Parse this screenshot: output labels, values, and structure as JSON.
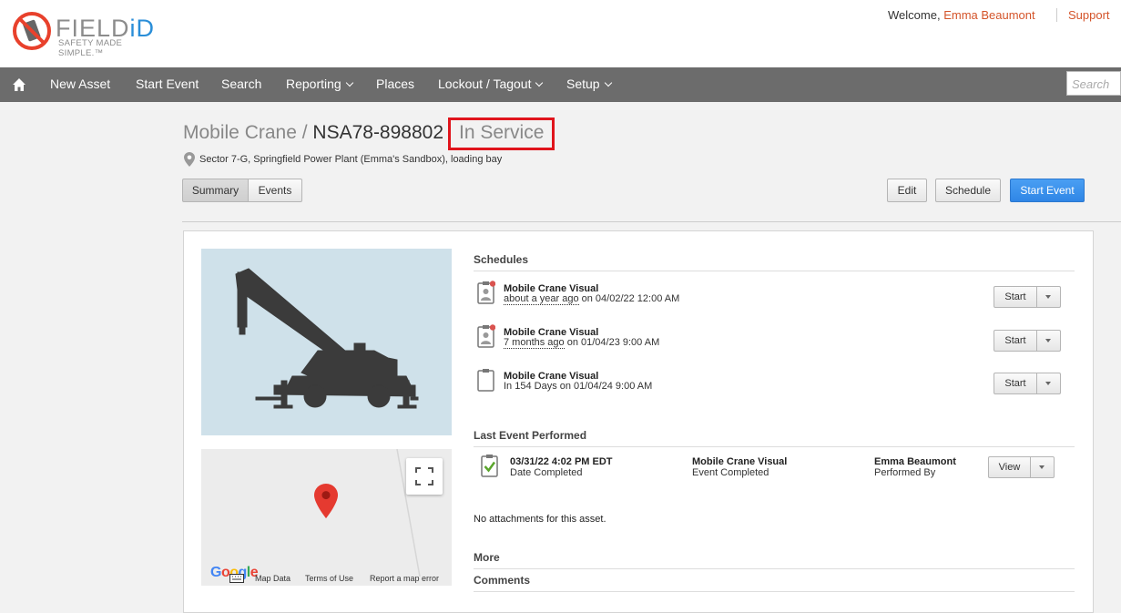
{
  "header": {
    "logo_text": "FIELD",
    "logo_accent": "iD",
    "logo_tagline": "SAFETY MADE SIMPLE.™",
    "welcome_label": "Welcome,",
    "user_name": "Emma Beaumont",
    "support_label": "Support"
  },
  "nav": {
    "items": [
      "New Asset",
      "Start Event",
      "Search",
      "Reporting",
      "Places",
      "Lockout / Tagout",
      "Setup"
    ],
    "search_placeholder": "Search"
  },
  "asset": {
    "type": "Mobile Crane /",
    "serial": "NSA78-898802",
    "status": "In Service",
    "location": "Sector 7-G, Springfield Power Plant (Emma's Sandbox), loading bay"
  },
  "tabs": [
    "Summary",
    "Events"
  ],
  "actions": {
    "edit": "Edit",
    "schedule": "Schedule",
    "start_event": "Start Event"
  },
  "schedules": {
    "heading": "Schedules",
    "items": [
      {
        "name": "Mobile Crane Visual",
        "relative": "about a year ago",
        "date": " on 04/02/22 12:00 AM",
        "button": "Start"
      },
      {
        "name": "Mobile Crane Visual",
        "relative": "7 months ago",
        "date": " on 01/04/23 9:00 AM",
        "button": "Start"
      },
      {
        "name": "Mobile Crane Visual",
        "relative": "",
        "date": "In 154 Days on 01/04/24 9:00 AM",
        "button": "Start"
      }
    ]
  },
  "last_event": {
    "heading": "Last Event Performed",
    "date": "03/31/22 4:02 PM EDT",
    "date_label": "Date Completed",
    "event_name": "Mobile Crane Visual",
    "event_label": "Event Completed",
    "performer": "Emma Beaumont",
    "performer_label": "Performed By",
    "view_button": "View"
  },
  "attachments_text": "No attachments for this asset.",
  "more_heading": "More",
  "comments_heading": "Comments",
  "map": {
    "google": "Google",
    "map_data": "Map Data",
    "terms": "Terms of Use",
    "report": "Report a map error"
  },
  "colors": {
    "nav_bg": "#6c6c6c",
    "accent": "#d4542a",
    "primary_button": "#2f86e6",
    "status_outline": "#e0141c"
  }
}
